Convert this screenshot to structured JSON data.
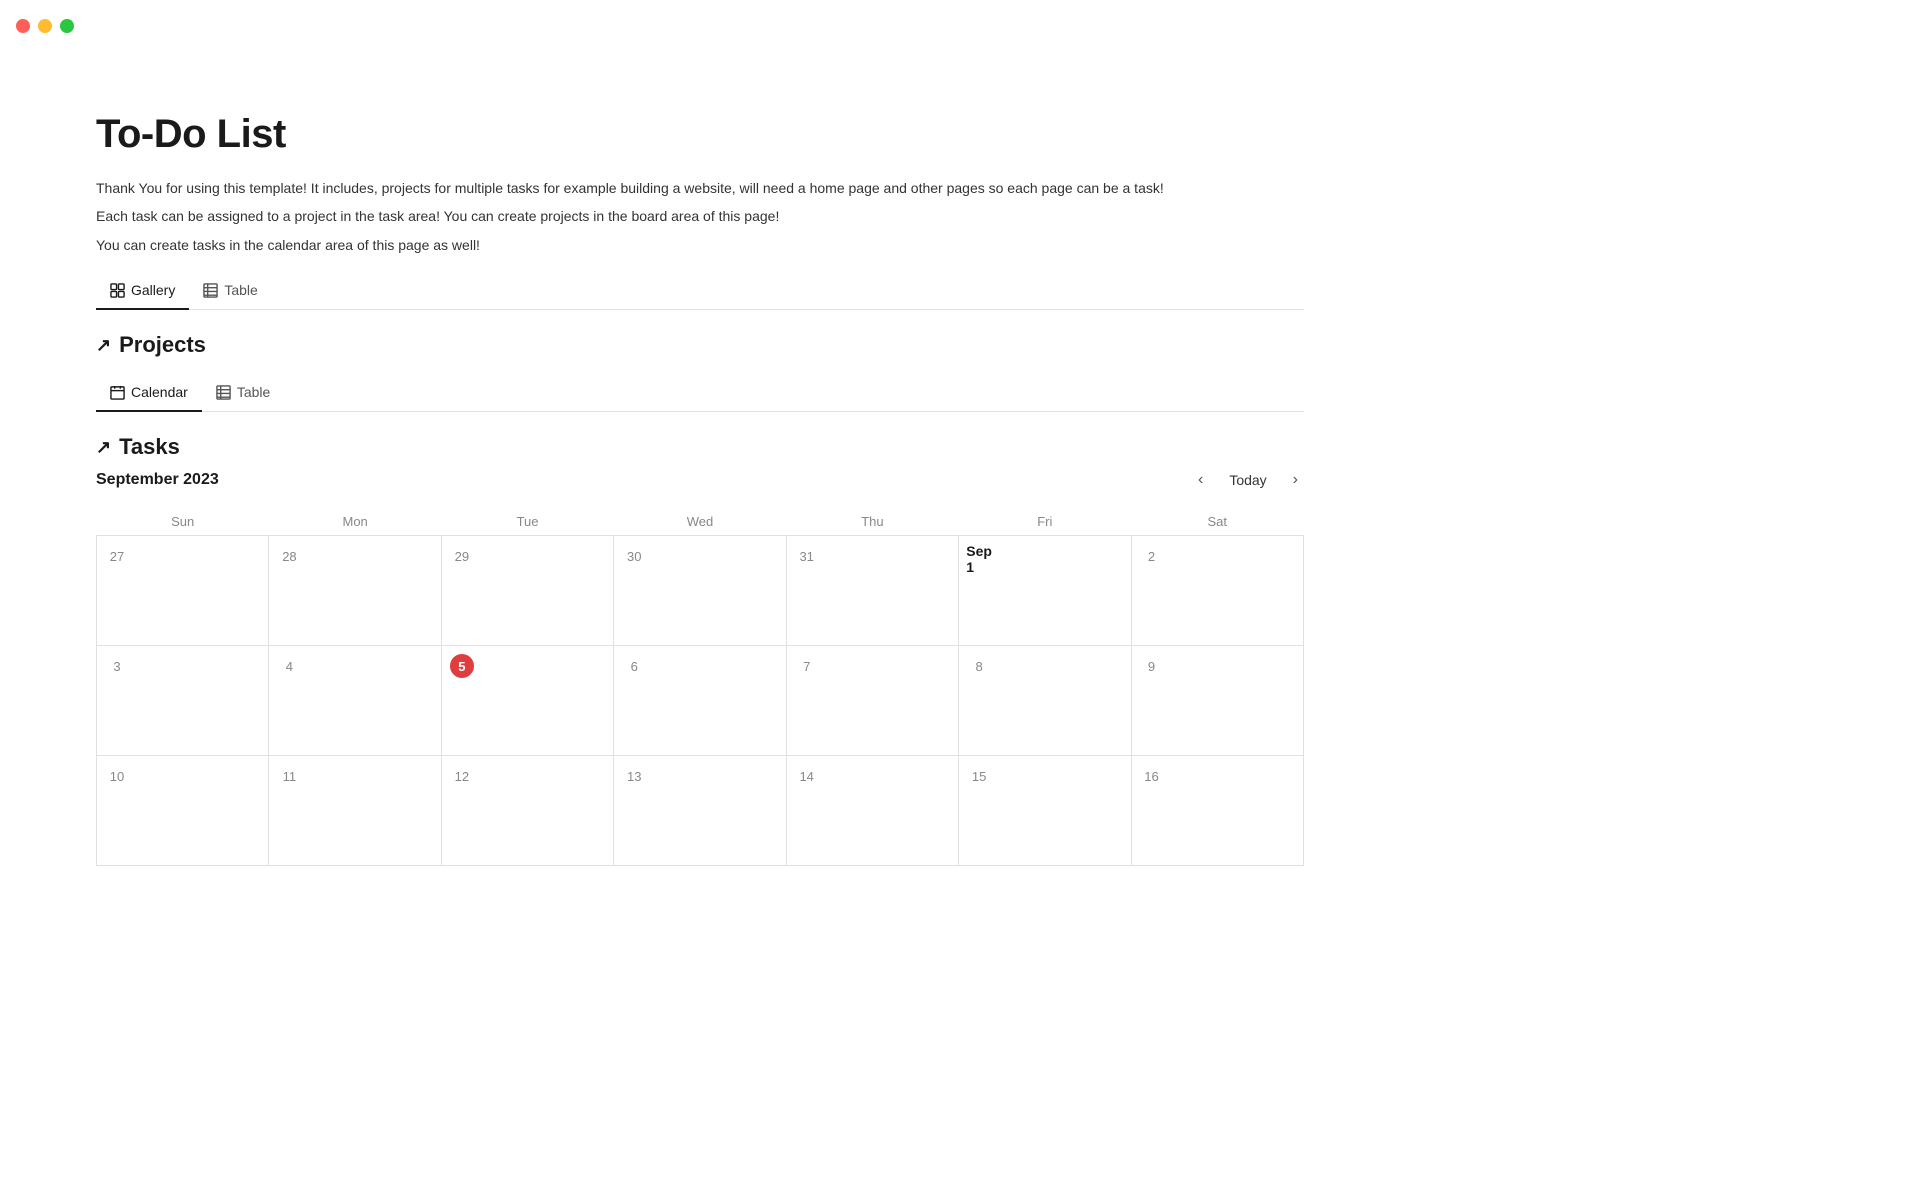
{
  "titlebar": {
    "traffic_lights": [
      "red",
      "yellow",
      "green"
    ]
  },
  "page": {
    "title": "To-Do List",
    "descriptions": [
      "Thank You for using this template! It includes, projects for multiple tasks for example building a website, will need a home page and other pages so each page can be a task!",
      "Each task can be assigned to a project in the task area! You can create projects in the board area of this page!",
      "You can create tasks in the calendar area of this page as well!"
    ]
  },
  "top_tabs": [
    {
      "label": "Gallery",
      "active": true,
      "icon": "gallery-icon"
    },
    {
      "label": "Table",
      "active": false,
      "icon": "table-icon"
    }
  ],
  "projects_section": {
    "heading": "Projects",
    "tabs": [
      {
        "label": "Calendar",
        "active": true,
        "icon": "calendar-icon"
      },
      {
        "label": "Table",
        "active": false,
        "icon": "table-icon"
      }
    ]
  },
  "tasks_section": {
    "heading": "Tasks"
  },
  "calendar": {
    "month_label": "September 2023",
    "today_btn": "Today",
    "days_of_week": [
      "Sun",
      "Mon",
      "Tue",
      "Wed",
      "Thu",
      "Fri",
      "Sat"
    ],
    "weeks": [
      [
        {
          "num": "27",
          "other": true
        },
        {
          "num": "28",
          "other": true
        },
        {
          "num": "29",
          "other": true
        },
        {
          "num": "30",
          "other": true
        },
        {
          "num": "31",
          "other": true
        },
        {
          "num": "Sep 1",
          "bold": true
        },
        {
          "num": "2"
        }
      ],
      [
        {
          "num": "3"
        },
        {
          "num": "4"
        },
        {
          "num": "5",
          "today": true
        },
        {
          "num": "6"
        },
        {
          "num": "7"
        },
        {
          "num": "8"
        },
        {
          "num": "9"
        }
      ],
      [
        {
          "num": "10"
        },
        {
          "num": "11"
        },
        {
          "num": "12"
        },
        {
          "num": "13"
        },
        {
          "num": "14"
        },
        {
          "num": "15"
        },
        {
          "num": "16"
        }
      ]
    ]
  }
}
